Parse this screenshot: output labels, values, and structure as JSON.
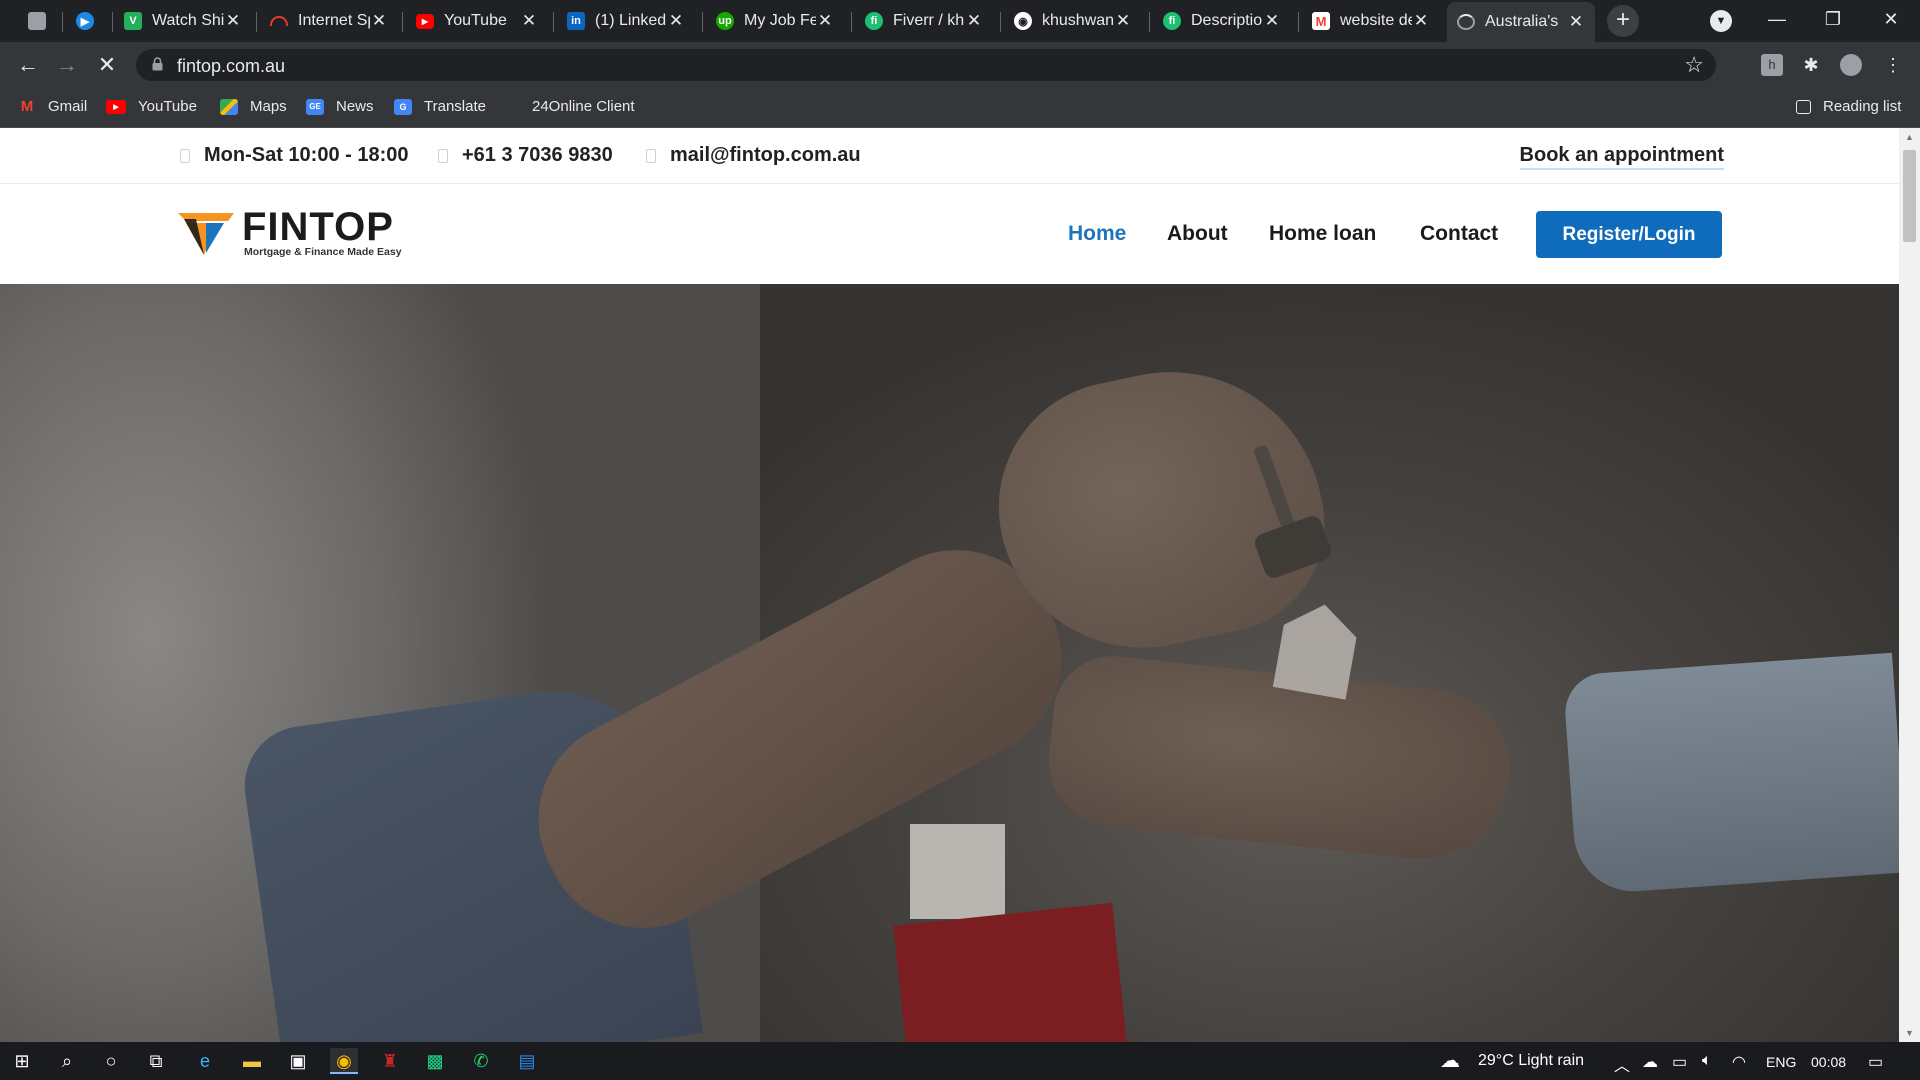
{
  "tabs": [
    {
      "title": "",
      "icon": "square-page-icon"
    },
    {
      "title": "",
      "icon": "play-circle-icon"
    },
    {
      "title": "Watch Shi",
      "icon": "v-logo-icon"
    },
    {
      "title": "Internet Sp",
      "icon": "speedometer-icon"
    },
    {
      "title": "YouTube",
      "icon": "youtube-icon"
    },
    {
      "title": "(1) Linked",
      "icon": "linkedin-icon"
    },
    {
      "title": "My Job Fe",
      "icon": "upwork-icon"
    },
    {
      "title": "Fiverr / kh",
      "icon": "fiverr-icon"
    },
    {
      "title": "khushwan",
      "icon": "github-icon"
    },
    {
      "title": "Descriptio",
      "icon": "fiverr-icon"
    },
    {
      "title": "website de",
      "icon": "gmail-icon"
    },
    {
      "title": "Australia's",
      "icon": "loading-icon",
      "active": true
    }
  ],
  "address": {
    "url": "fintop.com.au"
  },
  "bookmarks": [
    {
      "label": "Gmail",
      "icon": "gmail-icon"
    },
    {
      "label": "YouTube",
      "icon": "youtube-icon"
    },
    {
      "label": "Maps",
      "icon": "maps-icon"
    },
    {
      "label": "News",
      "icon": "news-icon"
    },
    {
      "label": "Translate",
      "icon": "translate-icon"
    },
    {
      "label": "24Online Client",
      "icon": ""
    }
  ],
  "reading_list": "Reading list",
  "site": {
    "topbar": {
      "hours": "Mon-Sat 10:00 - 18:00",
      "phone": "+61 3 7036 9830",
      "email": "mail@fintop.com.au",
      "book": "Book an appointment"
    },
    "logo": {
      "name": "FINTOP",
      "tagline": "Mortgage & Finance Made Easy"
    },
    "nav": [
      "Home",
      "About",
      "Home loan",
      "Contact"
    ],
    "active_nav": "Home",
    "register": "Register/Login",
    "colors": {
      "accent": "#0f6cbd",
      "active_link": "#1e74bb",
      "logo_orange": "#f7941d",
      "logo_blue": "#1e74bb"
    }
  },
  "taskbar": {
    "weather": "29°C  Light rain",
    "lang": "ENG",
    "time": "00:08"
  }
}
